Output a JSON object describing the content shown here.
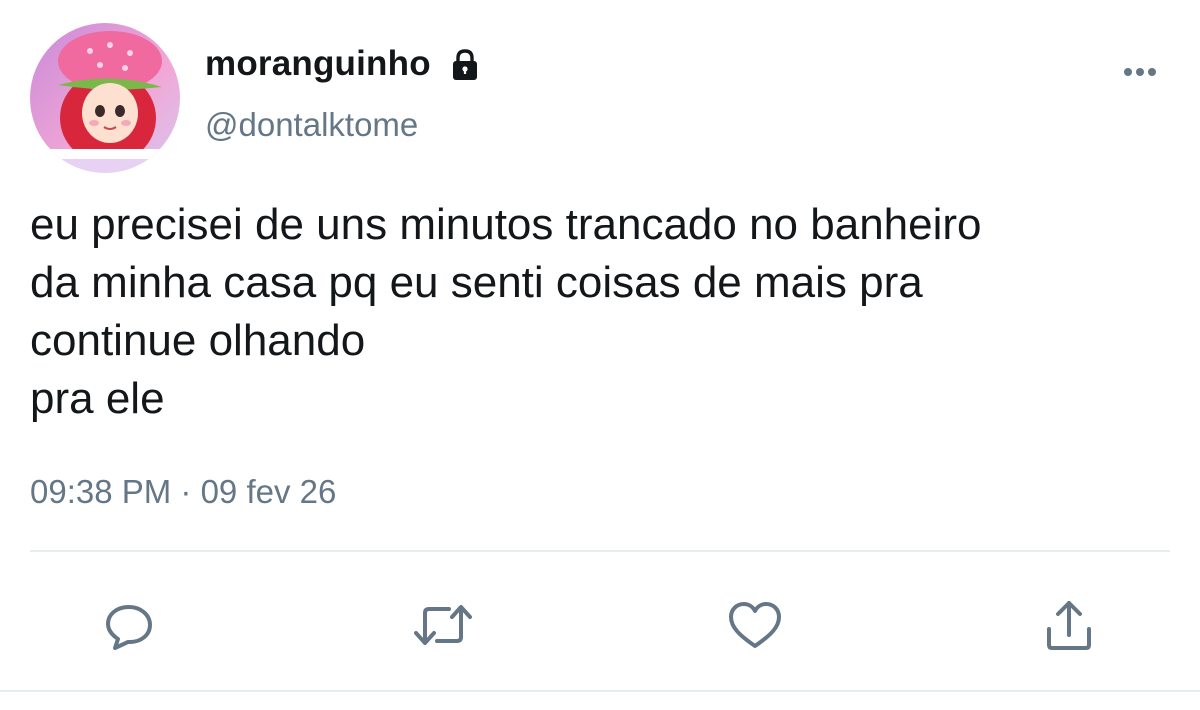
{
  "tweet": {
    "user": {
      "display_name": "moranguinho",
      "handle": "@dontalktome",
      "avatar_icon": "strawberry-girl-avatar",
      "protected_icon": "lock-icon"
    },
    "menu_icon": "more-horizontal-icon",
    "text": "eu precisei de uns minutos trancado no banheiro\nda minha casa pq eu senti coisas de mais pra\ncontinue olhando\npra ele",
    "timestamp": "09:38 PM · 09 fev 26",
    "actions": [
      {
        "name": "reply",
        "icon": "reply-icon"
      },
      {
        "name": "retweet",
        "icon": "retweet-icon"
      },
      {
        "name": "like",
        "icon": "heart-icon"
      },
      {
        "name": "share",
        "icon": "share-icon"
      }
    ],
    "colors": {
      "text": "#14171a",
      "secondary": "#657786",
      "icon": "#657786",
      "divider": "#e6ecf0"
    }
  }
}
